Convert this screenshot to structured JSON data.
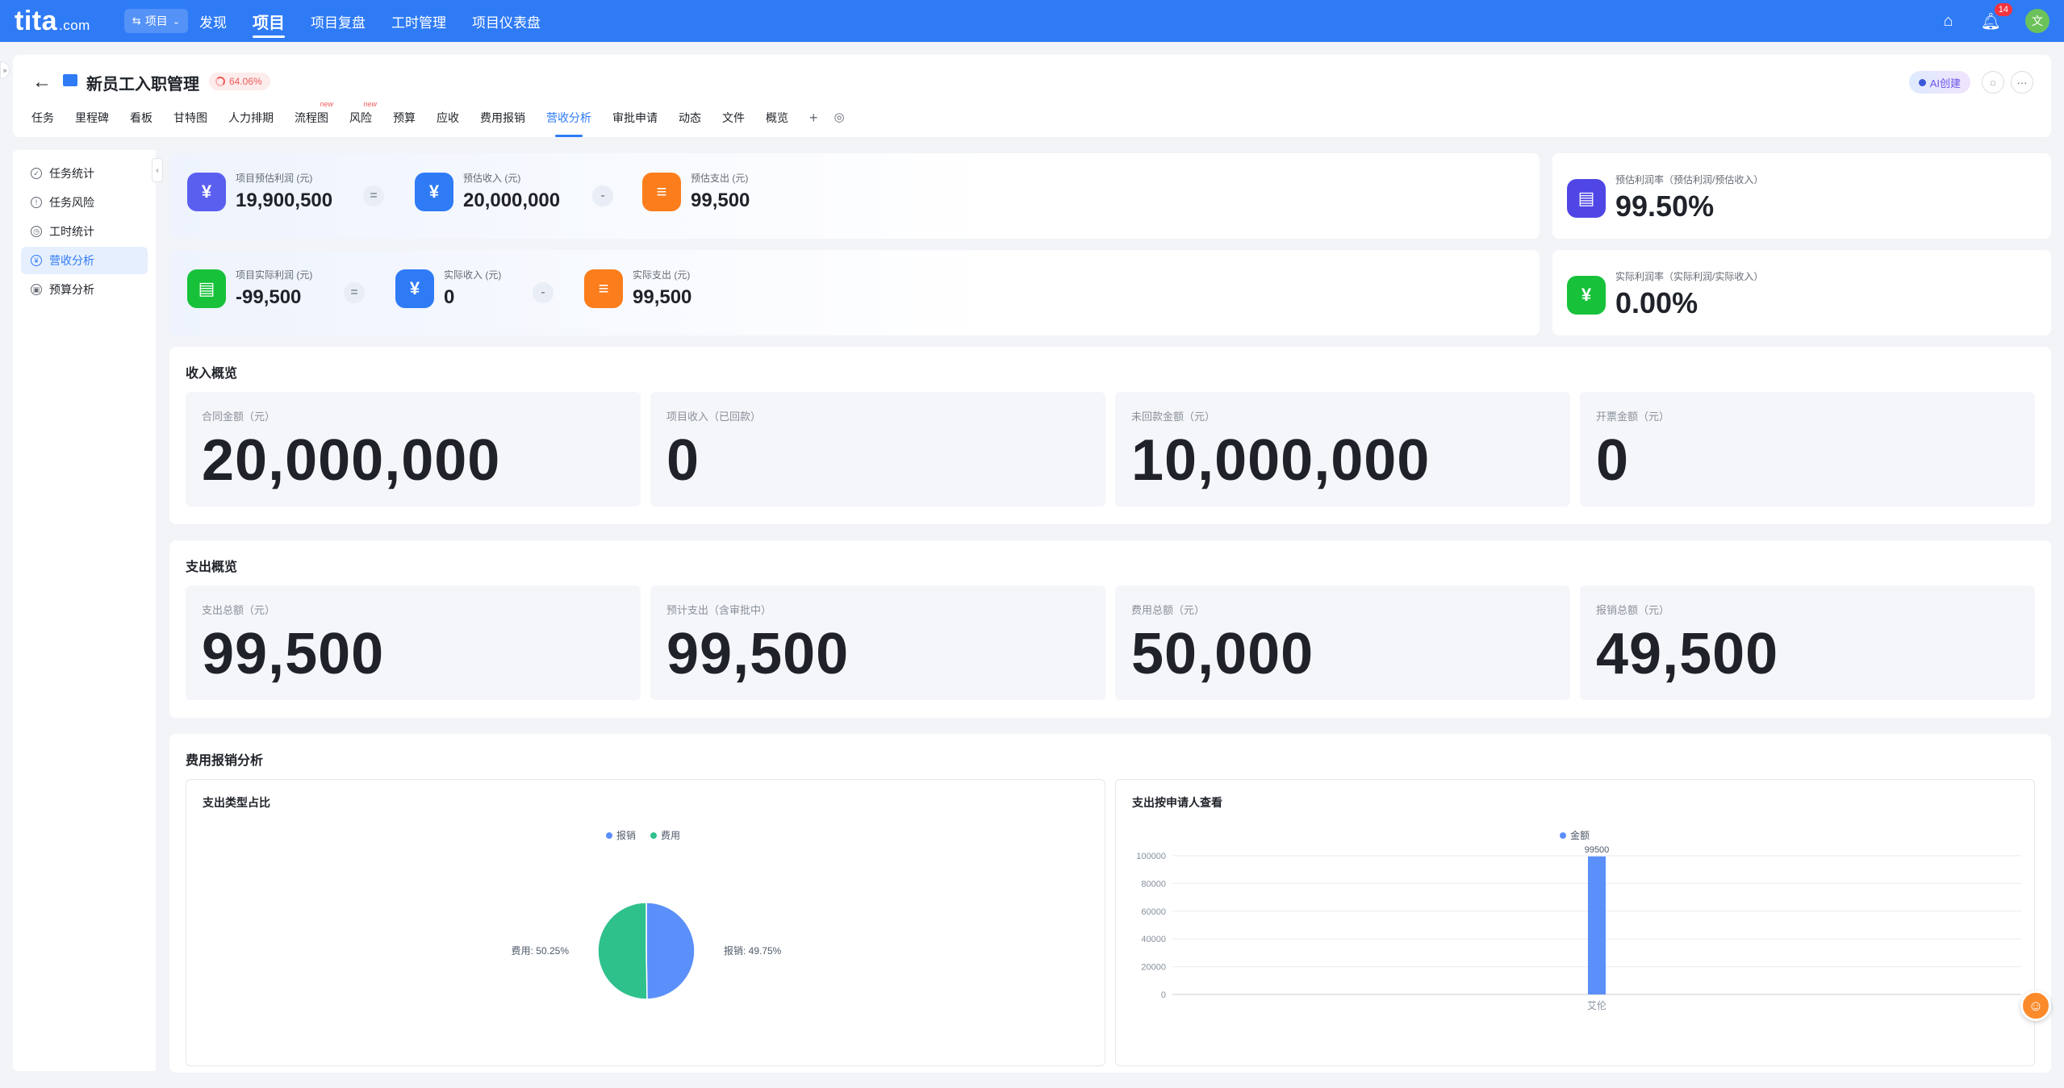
{
  "topbar": {
    "logo": "tita",
    "logo_suffix": ".com",
    "switcher_label": "项目",
    "nav": [
      "发现",
      "项目",
      "项目复盘",
      "工时管理",
      "项目仪表盘"
    ],
    "active_nav": "项目",
    "notification_count": "14",
    "avatar_text": "文"
  },
  "project": {
    "title": "新员工入职管理",
    "progress": "64.06%",
    "ai_label": "AI创建",
    "tabs": [
      {
        "label": "任务",
        "new": ""
      },
      {
        "label": "里程碑",
        "new": ""
      },
      {
        "label": "看板",
        "new": ""
      },
      {
        "label": "甘特图",
        "new": ""
      },
      {
        "label": "人力排期",
        "new": ""
      },
      {
        "label": "流程图",
        "new": "new"
      },
      {
        "label": "风险",
        "new": "new"
      },
      {
        "label": "预算",
        "new": ""
      },
      {
        "label": "应收",
        "new": ""
      },
      {
        "label": "费用报销",
        "new": ""
      },
      {
        "label": "营收分析",
        "new": ""
      },
      {
        "label": "审批申请",
        "new": ""
      },
      {
        "label": "动态",
        "new": ""
      },
      {
        "label": "文件",
        "new": ""
      },
      {
        "label": "概览",
        "new": ""
      }
    ],
    "active_tab": "营收分析"
  },
  "sidebar": {
    "items": [
      {
        "label": "任务统计",
        "icon": "check-square-icon"
      },
      {
        "label": "任务风险",
        "icon": "alert-icon"
      },
      {
        "label": "工时统计",
        "icon": "clock-icon"
      },
      {
        "label": "营收分析",
        "icon": "revenue-icon"
      },
      {
        "label": "预算分析",
        "icon": "budget-icon"
      }
    ],
    "active": "营收分析"
  },
  "estimate": {
    "profit_label": "项目预估利润 (元)",
    "profit_value": "19,900,500",
    "income_label": "预估收入 (元)",
    "income_value": "20,000,000",
    "expense_label": "预估支出 (元)",
    "expense_value": "99,500",
    "rate_label": "预估利润率（预估利润/预估收入）",
    "rate_value": "99.50%"
  },
  "actual": {
    "profit_label": "项目实际利润 (元)",
    "profit_value": "-99,500",
    "income_label": "实际收入 (元)",
    "income_value": "0",
    "expense_label": "实际支出 (元)",
    "expense_value": "99,500",
    "rate_label": "实际利润率（实际利润/实际收入）",
    "rate_value": "0.00%"
  },
  "operators": {
    "equals": "=",
    "minus": "-"
  },
  "income_overview": {
    "title": "收入概览",
    "cards": [
      {
        "label": "合同金额（元）",
        "value": "20,000,000"
      },
      {
        "label": "项目收入（已回款）",
        "value": "0"
      },
      {
        "label": "未回款金额（元）",
        "value": "10,000,000"
      },
      {
        "label": "开票金额（元）",
        "value": "0"
      }
    ]
  },
  "expense_overview": {
    "title": "支出概览",
    "cards": [
      {
        "label": "支出总额（元）",
        "value": "99,500"
      },
      {
        "label": "预计支出（含审批中）",
        "value": "99,500"
      },
      {
        "label": "费用总额（元）",
        "value": "50,000"
      },
      {
        "label": "报销总额（元）",
        "value": "49,500"
      }
    ]
  },
  "reimburse_analysis": {
    "title": "费用报销分析",
    "pie_title": "支出类型占比",
    "bar_title": "支出按申请人查看"
  },
  "chart_data": [
    {
      "type": "pie",
      "title": "支出类型占比",
      "legend": [
        "报销",
        "费用"
      ],
      "slices": [
        {
          "name": "报销",
          "value": 49.75,
          "label": "报销: 49.75%",
          "color": "#5b8ff9"
        },
        {
          "name": "费用",
          "value": 50.25,
          "label": "费用: 50.25%",
          "color": "#2fc18c"
        }
      ]
    },
    {
      "type": "bar",
      "title": "支出按申请人查看",
      "categories": [
        "艾伦"
      ],
      "series": [
        {
          "name": "金额",
          "values": [
            99500
          ],
          "color": "#5b8ff9"
        }
      ],
      "data_labels": [
        "99500"
      ],
      "ylim": [
        0,
        100000
      ],
      "yticks": [
        "0",
        "20000",
        "40000",
        "60000",
        "80000",
        "100000"
      ],
      "grid": true,
      "legend_position": "top"
    }
  ]
}
